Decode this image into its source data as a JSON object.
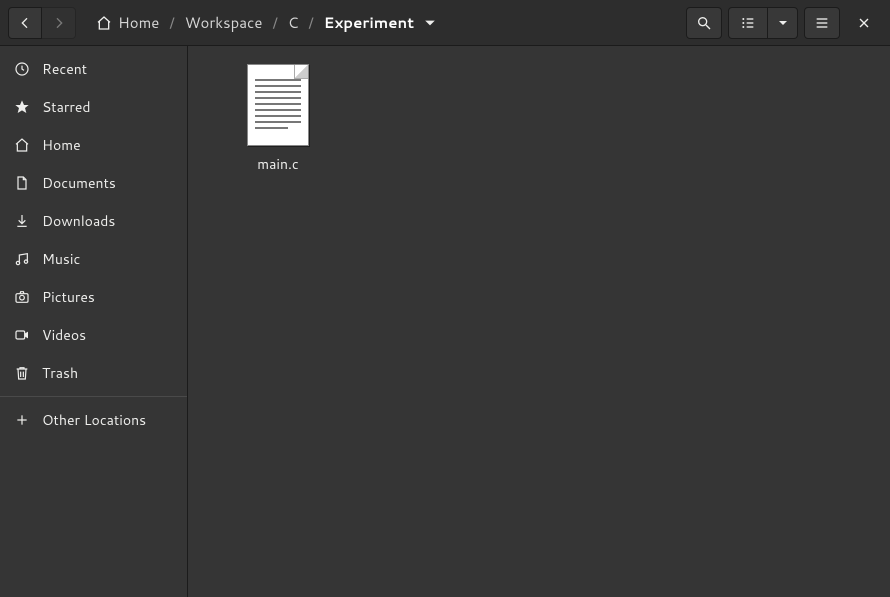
{
  "breadcrumb": {
    "home_label": "Home",
    "segments": [
      "Workspace",
      "C"
    ],
    "current": "Experiment"
  },
  "sidebar": {
    "items": [
      {
        "icon": "clock",
        "label": "Recent"
      },
      {
        "icon": "star",
        "label": "Starred"
      },
      {
        "icon": "home",
        "label": "Home"
      },
      {
        "icon": "doc",
        "label": "Documents"
      },
      {
        "icon": "download",
        "label": "Downloads"
      },
      {
        "icon": "music",
        "label": "Music"
      },
      {
        "icon": "camera",
        "label": "Pictures"
      },
      {
        "icon": "video",
        "label": "Videos"
      },
      {
        "icon": "trash",
        "label": "Trash"
      }
    ],
    "other_label": "Other Locations"
  },
  "files": [
    {
      "name": "main.c"
    }
  ]
}
